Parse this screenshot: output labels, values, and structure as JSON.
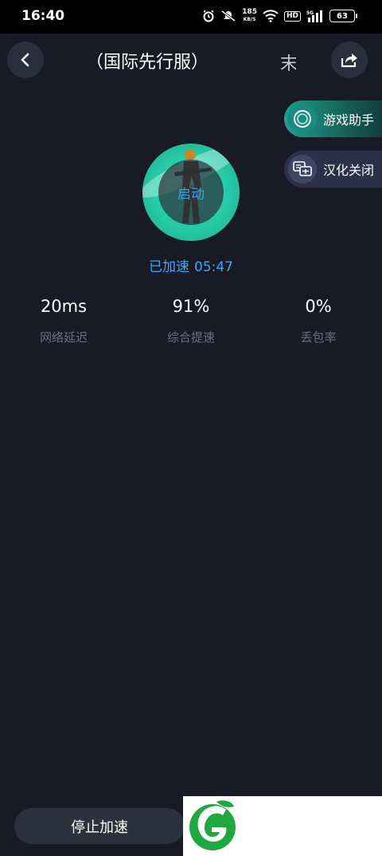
{
  "status_bar": {
    "time": "16:40",
    "net_speed_value": "185",
    "net_speed_unit": "KB/S",
    "hd": "HD",
    "signal_label": "5G",
    "battery": "63",
    "icons": [
      "alarm-icon",
      "mute-icon",
      "wifi-icon",
      "hd-icon",
      "signal-icon",
      "battery-icon"
    ]
  },
  "header": {
    "title": "（国际先行服）",
    "title_truncated": "末",
    "back_icon": "chevron-left-icon",
    "share_icon": "share-icon"
  },
  "side_actions": [
    {
      "label": "游戏助手",
      "icon": "assistant-icon"
    },
    {
      "label": "汉化关闭",
      "icon": "translate-icon"
    }
  ],
  "game": {
    "start_label": "启动",
    "status_label": "已加速",
    "elapsed": "05:47"
  },
  "stats": [
    {
      "value": "20ms",
      "label": "网络延迟"
    },
    {
      "value": "91%",
      "label": "综合提速"
    },
    {
      "value": "0%",
      "label": "丢包率"
    }
  ],
  "bottom": {
    "stop_label": "停止加速",
    "logo_icon": "leaf-logo"
  },
  "colors": {
    "background": "#181a25",
    "accent_blue": "#3fa6f0",
    "accent_teal": "#26c9a7",
    "logo_green": "#1fa83f"
  }
}
